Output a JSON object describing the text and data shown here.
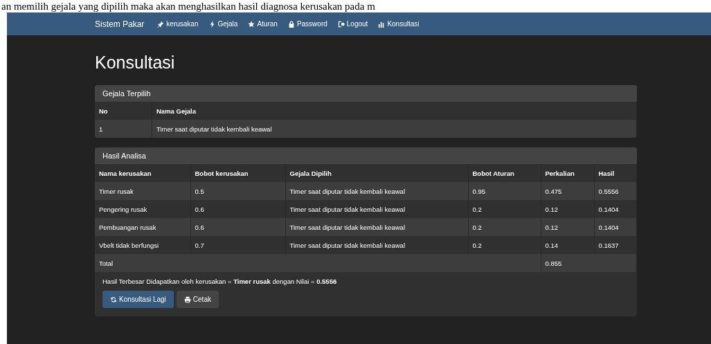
{
  "caption": "an memilih gejala yang dipilih maka akan menghasilkan hasil diagnosa kerusakan pada m",
  "navbar": {
    "brand": "Sistem Pakar",
    "items": [
      {
        "label": "kerusakan",
        "kind": "pin"
      },
      {
        "label": "Gejala",
        "kind": "bolt"
      },
      {
        "label": "Aturan",
        "kind": "star"
      },
      {
        "label": "Password",
        "kind": "lock"
      },
      {
        "label": "Logout",
        "kind": "logout"
      },
      {
        "label": "Konsultasi",
        "kind": "chart"
      }
    ]
  },
  "title": "Konsultasi",
  "gejala_panel": {
    "heading": "Gejala Terpilih",
    "columns": [
      "No",
      "Nama Gejala"
    ],
    "rows": [
      [
        "1",
        "Timer saat diputar tidak kembali keawal"
      ]
    ]
  },
  "hasil_panel": {
    "heading": "Hasil Analisa",
    "columns": [
      "Nama kerusakan",
      "Bobot kerusakan",
      "Gejala Dipilih",
      "Bobot Aturan",
      "Perkalian",
      "Hasil"
    ],
    "rows": [
      [
        "Timer rusak",
        "0.5",
        "Timer saat diputar tidak kembali keawal",
        "0.95",
        "0.475",
        "0.5556"
      ],
      [
        "Pengering rusak",
        "0.6",
        "Timer saat diputar tidak kembali keawal",
        "0.2",
        "0.12",
        "0.1404"
      ],
      [
        "Pembuangan rusak",
        "0.6",
        "Timer saat diputar tidak kembali keawal",
        "0.2",
        "0.12",
        "0.1404"
      ],
      [
        "Vbelt tidak berfungsi",
        "0.7",
        "Timer saat diputar tidak kembali keawal",
        "0.2",
        "0.14",
        "0.1637"
      ]
    ],
    "total": {
      "label": "Total",
      "value": "0.855"
    },
    "summary": "Hasil Terbesar Didapatkan oleh kerusakan = **Timer rusak** dengan Nilai = **0.5556**",
    "buttons": [
      {
        "label": "Konsultasi Lagi",
        "kind": "refresh"
      },
      {
        "label": "Cetak",
        "kind": "print"
      }
    ]
  }
}
